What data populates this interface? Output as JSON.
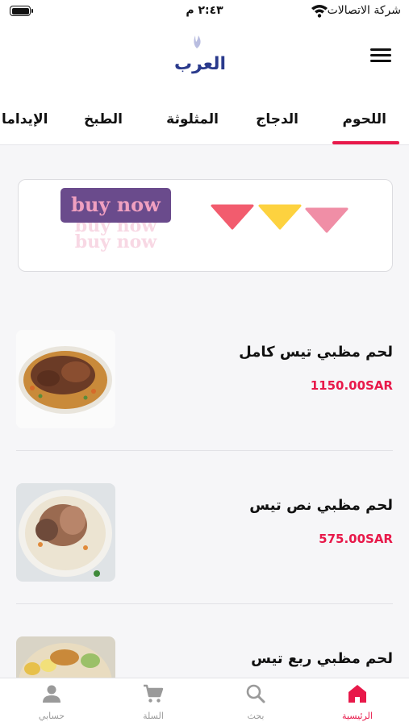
{
  "status_bar": {
    "time": "٢:٤٣ م",
    "carrier": "شركة الاتصالات"
  },
  "header": {
    "logo_text": "العرب"
  },
  "tabs": [
    {
      "label": "اللحوم",
      "active": true
    },
    {
      "label": "الدجاج",
      "active": false
    },
    {
      "label": "المثلوثة",
      "active": false
    },
    {
      "label": "الطبخ",
      "active": false
    },
    {
      "label": "الإيداما",
      "active": false
    }
  ],
  "banner": {
    "button_label": "buy now",
    "echo_1": "buy now",
    "echo_2": "buy now",
    "triangle_colors": [
      "#f25c6e",
      "#fdd23f",
      "#f08ea6"
    ]
  },
  "products": [
    {
      "title": "لحم مظبي تيس كامل",
      "price": "1150.00SAR"
    },
    {
      "title": "لحم مظبي نص تيس",
      "price": "575.00SAR"
    },
    {
      "title": "لحم مظبي ربع تيس",
      "price": ""
    }
  ],
  "bottom_nav": [
    {
      "label": "الرئيسية",
      "icon": "home-icon",
      "active": true
    },
    {
      "label": "بحث",
      "icon": "search-icon",
      "active": false
    },
    {
      "label": "السلة",
      "icon": "cart-icon",
      "active": false
    },
    {
      "label": "حسابي",
      "icon": "person-icon",
      "active": false
    }
  ],
  "colors": {
    "accent": "#e8194a",
    "banner_button": "#6a4b8c",
    "logo": "#2a3a8c"
  }
}
